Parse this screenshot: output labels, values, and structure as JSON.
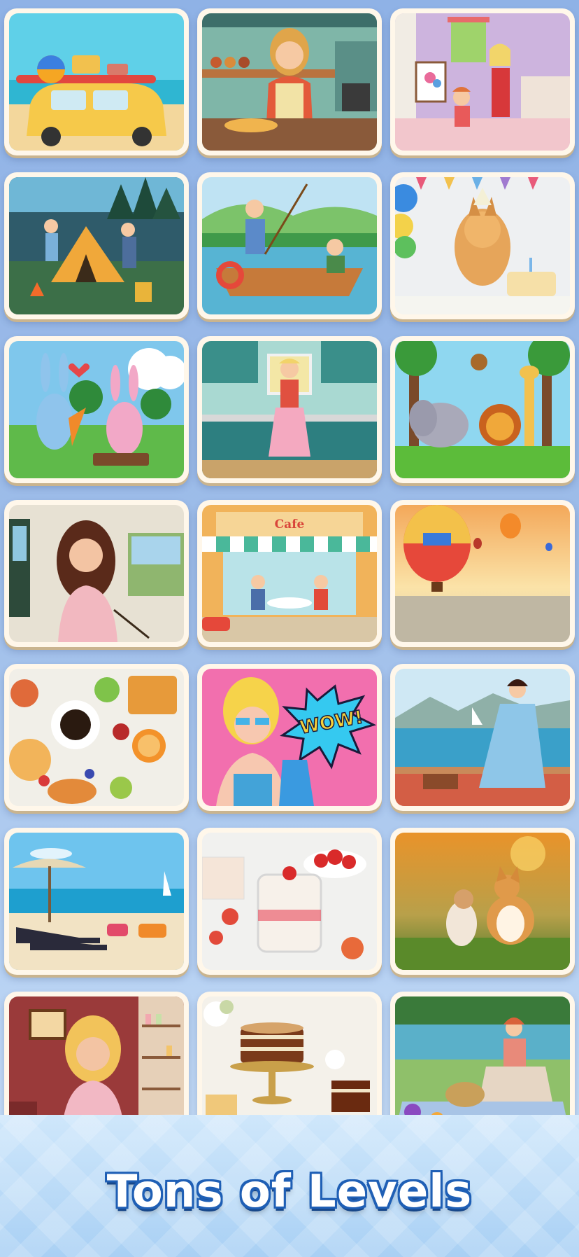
{
  "footer": {
    "title": "Tons of Levels"
  },
  "levels": [
    {
      "scene": "beach-car",
      "cafe_sign": ""
    },
    {
      "scene": "kitchen-woman",
      "cafe_sign": ""
    },
    {
      "scene": "kids-painting",
      "cafe_sign": ""
    },
    {
      "scene": "family-camping",
      "cafe_sign": ""
    },
    {
      "scene": "fishing-boat",
      "cafe_sign": ""
    },
    {
      "scene": "birthday-dog",
      "cafe_sign": ""
    },
    {
      "scene": "bunnies-carrot",
      "cafe_sign": ""
    },
    {
      "scene": "retro-kitchen",
      "cafe_sign": ""
    },
    {
      "scene": "jungle-animals",
      "cafe_sign": ""
    },
    {
      "scene": "woman-painter",
      "cafe_sign": ""
    },
    {
      "scene": "street-cafe",
      "cafe_sign": "Cafe"
    },
    {
      "scene": "hot-air-balloons",
      "cafe_sign": ""
    },
    {
      "scene": "breakfast-table",
      "cafe_sign": ""
    },
    {
      "scene": "pop-art-wow",
      "cafe_sign": "WOW!"
    },
    {
      "scene": "lakeside-picnic",
      "cafe_sign": ""
    },
    {
      "scene": "beach-loungers",
      "cafe_sign": ""
    },
    {
      "scene": "strawberry-dessert",
      "cafe_sign": ""
    },
    {
      "scene": "cat-and-corgi",
      "cafe_sign": ""
    },
    {
      "scene": "perfume-shop",
      "cafe_sign": ""
    },
    {
      "scene": "layer-cake",
      "cafe_sign": ""
    },
    {
      "scene": "riverside-picnic",
      "cafe_sign": ""
    }
  ]
}
